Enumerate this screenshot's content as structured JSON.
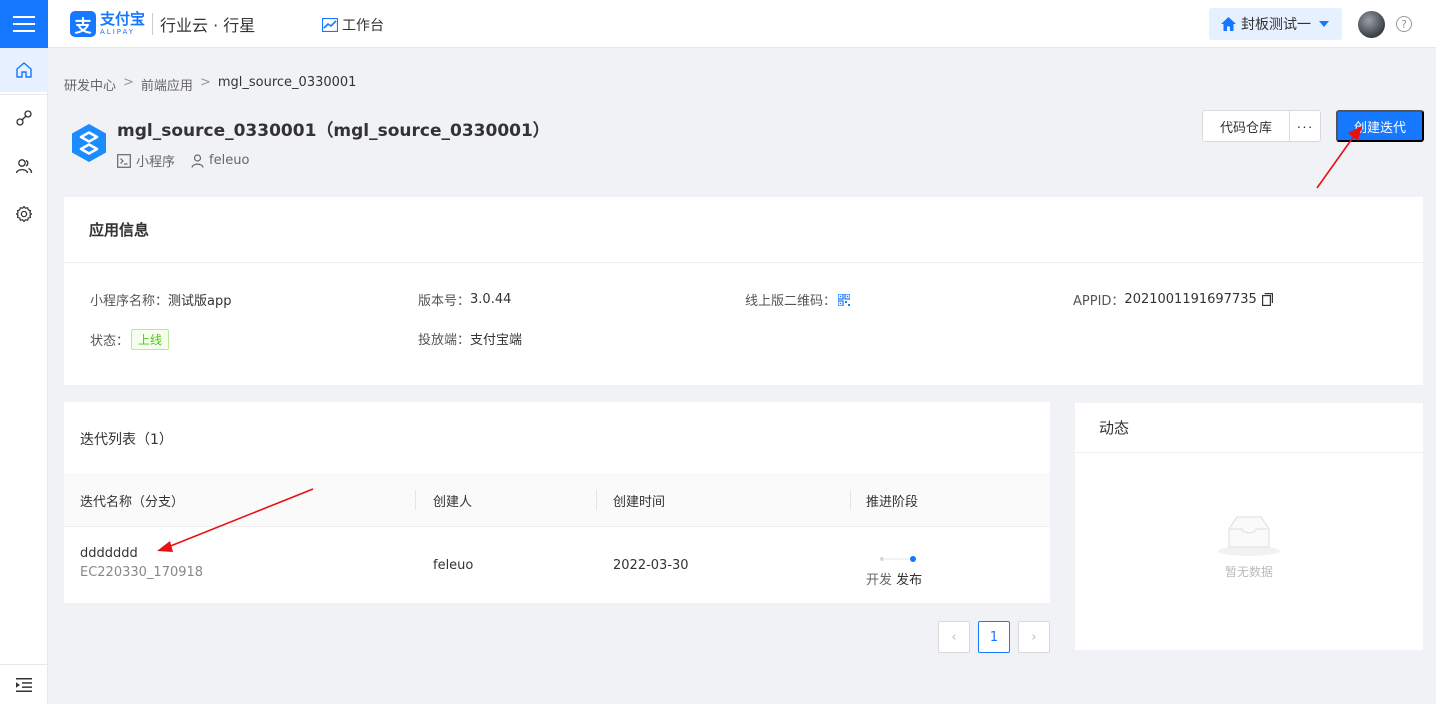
{
  "header": {
    "logo_mark": "支",
    "logo_cn": "支付宝",
    "logo_en": "ALIPAY",
    "product": "行业云 · 行星",
    "workbench": "工作台",
    "tenant": "封板测试一",
    "help": "?"
  },
  "sidebar": {
    "items": [
      "home-icon",
      "link-icon",
      "users-icon",
      "gear-icon"
    ],
    "bottom": "collapse-icon"
  },
  "breadcrumb": [
    "研发中心",
    "前端应用",
    "mgl_source_0330001"
  ],
  "breadcrumb_sep": ">",
  "app": {
    "title": "mgl_source_0330001（mgl_source_0330001）",
    "type": "小程序",
    "owner": "feleuo"
  },
  "actions": {
    "repo": "代码仓库",
    "more": "···",
    "create": "创建迭代"
  },
  "info": {
    "heading": "应用信息",
    "name_label": "小程序名称：",
    "name_value": "测试版app",
    "version_label": "版本号：",
    "version_value": "3.0.44",
    "qr_label": "线上版二维码：",
    "appid_label": "APPID：",
    "appid_value": "2021001191697735",
    "status_label": "状态：",
    "status_value": "上线",
    "platform_label": "投放端：",
    "platform_value": "支付宝端",
    "status_color": "#52c41a"
  },
  "iterations": {
    "title": "迭代列表（1）",
    "columns": [
      "迭代名称（分支）",
      "创建人",
      "创建时间",
      "推进阶段"
    ],
    "rows": [
      {
        "name": "ddddddd",
        "branch": "EC220330_170918",
        "creator": "feleuo",
        "created": "2022-03-30",
        "stage_dev": "开发",
        "stage_pub": "发布"
      }
    ]
  },
  "pagination": {
    "prev": "‹",
    "current": "1",
    "next": "›"
  },
  "feed": {
    "title": "动态",
    "empty": "暂无数据"
  },
  "colors": {
    "primary": "#1677ff",
    "annotation_arrow": "#e81010"
  }
}
